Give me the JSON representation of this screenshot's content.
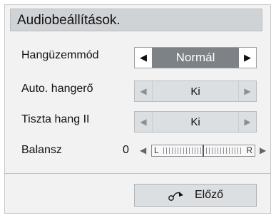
{
  "title": "Audiobeállítások.",
  "rows": [
    {
      "label": "Hangüzemmód",
      "value": "Normál"
    },
    {
      "label": "Auto. hangerő",
      "value": "Ki"
    },
    {
      "label": "Tiszta hang II",
      "value": "Ki"
    }
  ],
  "balance": {
    "label": "Balansz",
    "value": "0",
    "left_label": "L",
    "right_label": "R",
    "position_fraction": 0.5
  },
  "footer": {
    "prev_label": "Előző"
  },
  "colors": {
    "selected": "#7d8286",
    "title_bg": "#cfd3d6"
  }
}
